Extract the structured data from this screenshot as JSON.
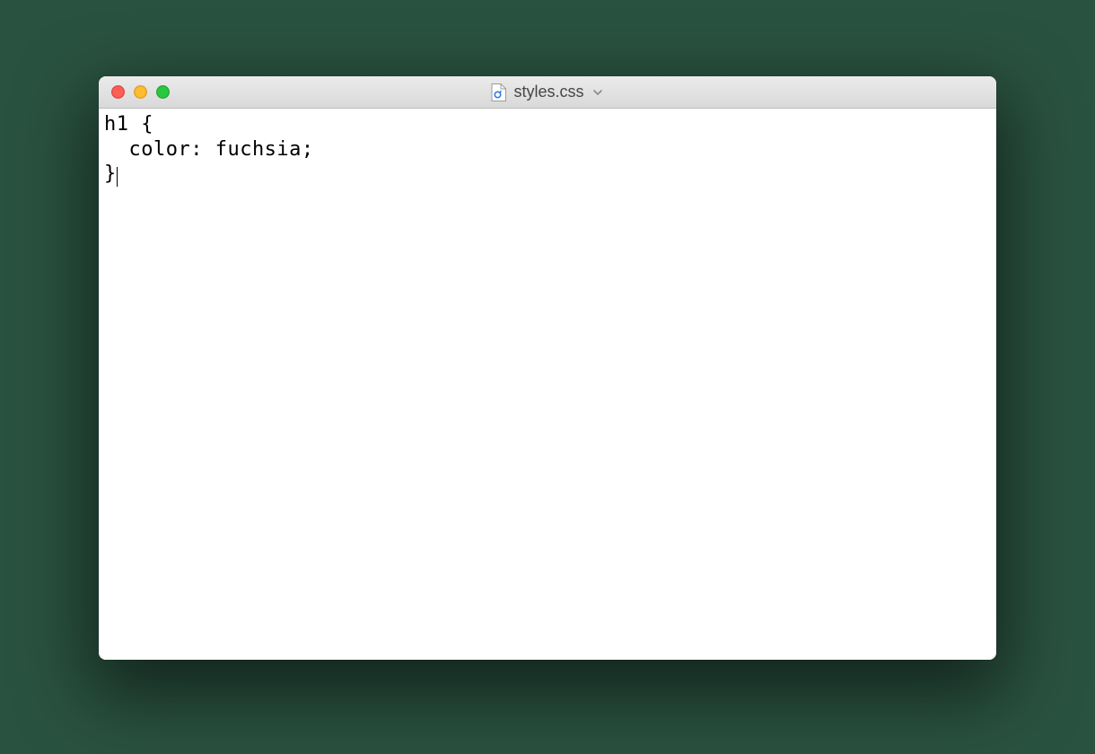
{
  "window": {
    "title": "styles.css",
    "traffic_lights": {
      "close": "close",
      "minimize": "minimize",
      "maximize": "maximize"
    }
  },
  "editor": {
    "content": "h1 {\n  color: fuchsia;\n}",
    "cursor_after_last_char": true
  }
}
